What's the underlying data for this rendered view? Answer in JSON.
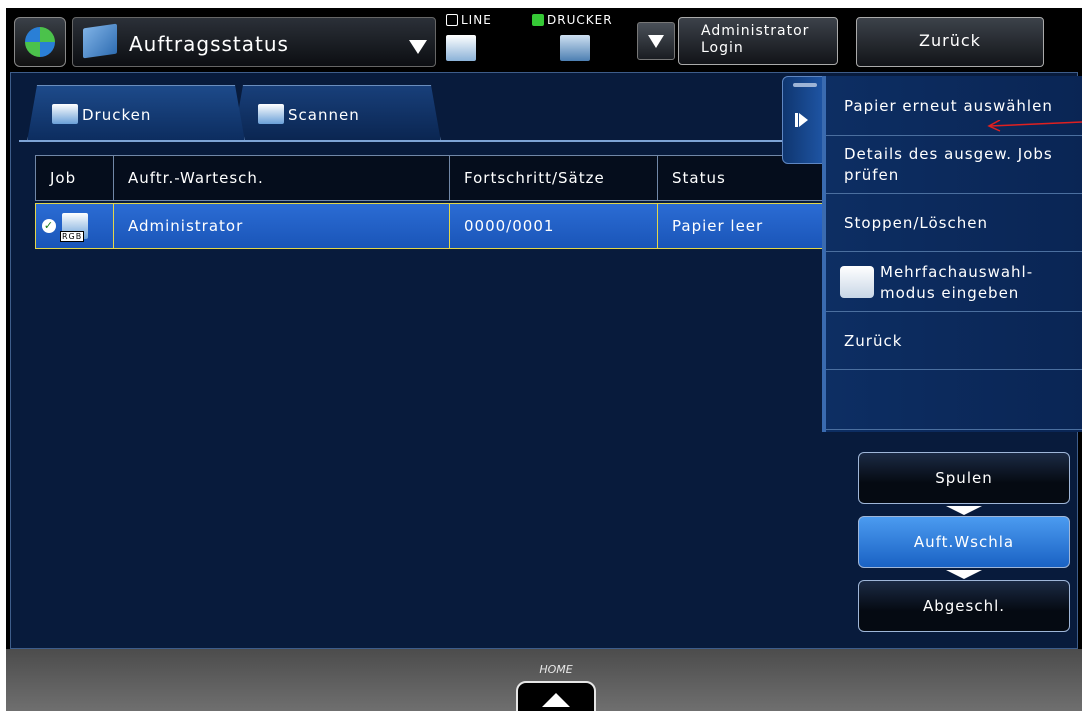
{
  "header": {
    "mode_label": "Auftragsstatus",
    "line_label": "LINE",
    "printer_label": "DRUCKER",
    "admin_login_label": "Administrator Login",
    "back_label": "Zurück"
  },
  "tabs": [
    {
      "label": "Drucken",
      "active": true
    },
    {
      "label": "Scannen",
      "active": false
    }
  ],
  "table": {
    "columns": [
      "Job",
      "Auftr.-Wartesch.",
      "Fortschritt/Sätze",
      "Status"
    ],
    "rows": [
      {
        "job_tag": "RGB",
        "owner": "Administrator",
        "progress": "0000/0001",
        "status": "Papier leer",
        "selected": true
      }
    ]
  },
  "side_menu": {
    "items": [
      {
        "label": "Papier erneut auswählen"
      },
      {
        "label": "Details des ausgew. Jobs prüfen"
      },
      {
        "label": "Stoppen/Löschen"
      },
      {
        "label": "Mehrfachauswahl- modus eingeben"
      },
      {
        "label": "Zurück"
      }
    ]
  },
  "view_buttons": [
    {
      "label": "Spulen",
      "active": false
    },
    {
      "label": "Auft.Wschla",
      "active": true
    },
    {
      "label": "Abgeschl.",
      "active": false
    }
  ],
  "footer": {
    "home_label": "HOME"
  },
  "colors": {
    "panel_blue": "#081b3c",
    "selected_row": "#2b6cd4",
    "row_border": "#e3d74a",
    "annotation_arrow": "#e02020"
  },
  "icons": {
    "app": "job-status-icon",
    "line": "line-device-icon",
    "printer": "printer-device-icon"
  }
}
